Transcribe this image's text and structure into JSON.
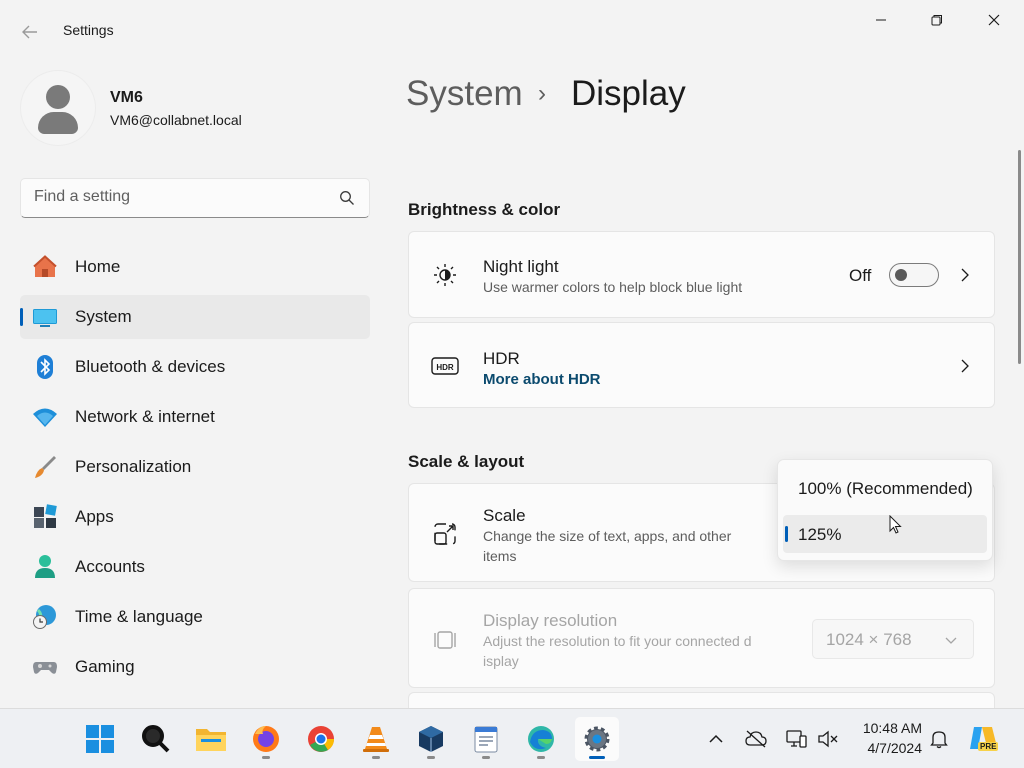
{
  "window": {
    "title": "Settings"
  },
  "account": {
    "name": "VM6",
    "email": "VM6@collabnet.local"
  },
  "search": {
    "placeholder": "Find a setting",
    "value": ""
  },
  "sidebar": {
    "items": [
      {
        "label": "Home",
        "icon": "home-icon",
        "selected": false
      },
      {
        "label": "System",
        "icon": "system-icon",
        "selected": true
      },
      {
        "label": "Bluetooth & devices",
        "icon": "bluetooth-icon",
        "selected": false
      },
      {
        "label": "Network & internet",
        "icon": "wifi-icon",
        "selected": false
      },
      {
        "label": "Personalization",
        "icon": "brush-icon",
        "selected": false
      },
      {
        "label": "Apps",
        "icon": "apps-icon",
        "selected": false
      },
      {
        "label": "Accounts",
        "icon": "accounts-icon",
        "selected": false
      },
      {
        "label": "Time & language",
        "icon": "time-language-icon",
        "selected": false
      },
      {
        "label": "Gaming",
        "icon": "gamepad-icon",
        "selected": false
      }
    ]
  },
  "breadcrumb": {
    "parent": "System",
    "separator": "›",
    "current": "Display"
  },
  "sections": {
    "brightness": "Brightness & color",
    "scale_layout": "Scale & layout"
  },
  "night_light": {
    "title": "Night light",
    "subtitle": "Use warmer colors to help block blue light",
    "state_label": "Off",
    "on": false
  },
  "hdr": {
    "title": "HDR",
    "link": "More about HDR"
  },
  "scale": {
    "title": "Scale",
    "subtitle_line1": "Change the size of text, apps, and other",
    "subtitle_line2": "items",
    "options": [
      "100% (Recommended)",
      "125%"
    ],
    "selected": "125%"
  },
  "resolution": {
    "title": "Display resolution",
    "subtitle_line1": "Adjust the resolution to fit your connected d",
    "subtitle_line2": "isplay",
    "value": "1024 × 768"
  },
  "taskbar": {
    "time": "10:48 AM",
    "date": "4/7/2024",
    "pre_badge": "PRE"
  },
  "colors": {
    "accent": "#005fb8",
    "background": "#f3f3f3",
    "card": "#fbfbfb",
    "link": "#0b4a6e"
  }
}
